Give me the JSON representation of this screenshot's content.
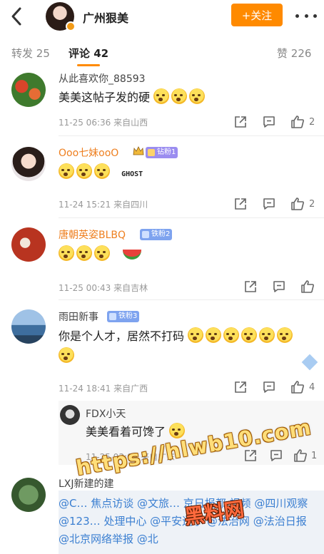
{
  "header": {
    "title": "广州狠美",
    "follow_label": "+关注"
  },
  "tabs": {
    "repost_label": "转发",
    "repost_count": "25",
    "comments_label": "评论",
    "comments_count": "42",
    "likes_label": "赞",
    "likes_count": "226"
  },
  "comments": [
    {
      "nick": "从此喜欢你_88593",
      "text": "美美这帖子发的硬",
      "emoji_count": 3,
      "meta": "11-25 06:36 来自山西",
      "likes": "2"
    },
    {
      "nick": "Ooo七妹ooO",
      "badge": "钻粉1",
      "meta": "11-24 15:21 来自四川",
      "likes": "2",
      "sticker_text": "GHOST"
    },
    {
      "nick": "唐朝英姿BLBQ",
      "badge": "铁粉2",
      "meta": "11-25 00:43 来自吉林",
      "likes": ""
    },
    {
      "nick": "雨田新事",
      "badge": "铁粉3",
      "text": "你是个人才，居然不打码",
      "meta": "11-24 18:41 来自广西",
      "likes": "4"
    },
    {
      "nick": "LXJ新建的建",
      "quote": "@C… 焦点访谈 @文旅… 京日报都 视频 @四川观察 @123… 处理中心 @平安辽宁 @法治网 @法治日报 @北京网络举报 @北"
    }
  ],
  "reply": {
    "nick": "FDX小天",
    "text": "美美看着可馋了",
    "meta": "11-25 03:09 来自广东",
    "likes": "1"
  },
  "watermark": {
    "url": "https://hlwb10.com",
    "brand": "黑料网"
  },
  "colors": {
    "accent": "#ff8a00",
    "nick_orange": "#ee7f1f",
    "link_blue": "#3b7fd1"
  }
}
